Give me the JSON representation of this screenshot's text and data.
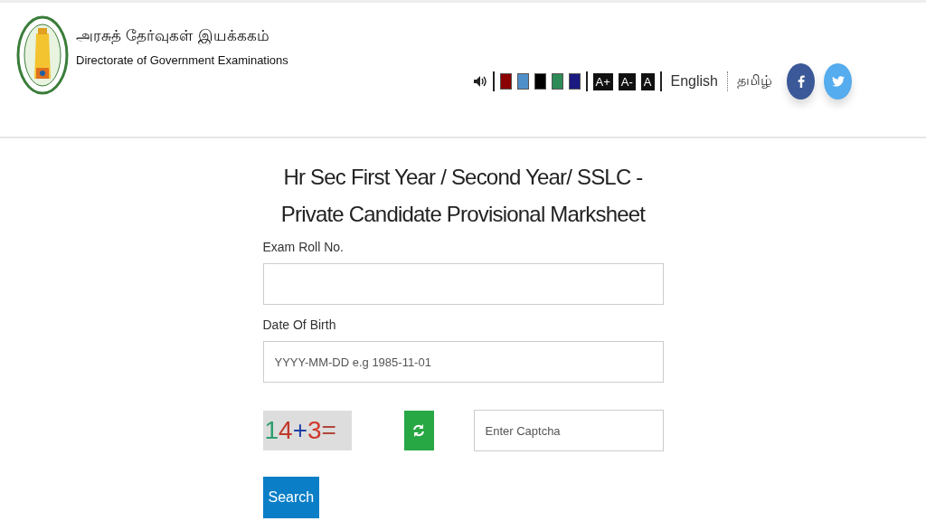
{
  "header": {
    "title_tamil": "அரசுத் தேர்வுகள் இயக்ககம்",
    "title_english": "Directorate of Government Examinations"
  },
  "toolbar": {
    "theme_colors": [
      {
        "color": "#8b0000"
      },
      {
        "color": "#4f8fc9"
      },
      {
        "color": "#000000"
      },
      {
        "color": "#2e8b57"
      },
      {
        "color": "#1a1a80"
      }
    ],
    "font_sizes": [
      "A+",
      "A-",
      "A"
    ],
    "languages": [
      "English",
      "தமிழ்"
    ],
    "social": [
      {
        "kind": "facebook"
      },
      {
        "kind": "twitter"
      }
    ]
  },
  "form": {
    "heading_lines": [
      "Hr Sec First Year / Second Year/ SSLC -",
      "Private Candidate Provisional Marksheet"
    ],
    "fields": [
      {
        "label": "Exam Roll No."
      },
      {
        "label": "Date Of Birth",
        "placeholder": "YYYY-MM-DD e.g 1985-11-01"
      }
    ],
    "captcha": {
      "parts": [
        {
          "text": "1",
          "color": "#2e9e6e"
        },
        {
          "text": "4",
          "color": "#c0392b"
        },
        {
          "text": "+",
          "color": "#1f3fa8"
        },
        {
          "text": "3",
          "color": "#d0392b"
        },
        {
          "text": "=",
          "color": "#b0453a"
        }
      ],
      "placeholder": "Enter Captcha"
    },
    "submit": "Search"
  }
}
